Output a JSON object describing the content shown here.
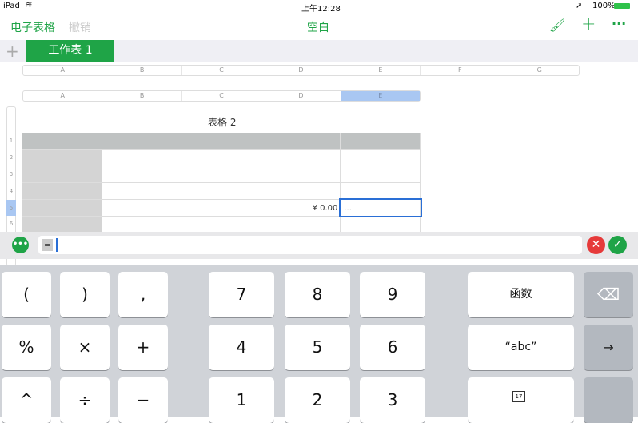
{
  "status": {
    "device": "iPad",
    "time": "上午12:28",
    "battery": "100%"
  },
  "toolbar": {
    "back": "电子表格",
    "undo": "撤销",
    "title": "空白"
  },
  "sheet_tab": "工作表 1",
  "columns_top": [
    "A",
    "B",
    "C",
    "D",
    "E",
    "F",
    "G"
  ],
  "columns_table": [
    "A",
    "B",
    "C",
    "D",
    "E"
  ],
  "table_title": "表格 2",
  "row_numbers": [
    "1",
    "2",
    "3",
    "4",
    "5",
    "6"
  ],
  "cell_d5": "¥ 0.00",
  "cell_e5": "...",
  "formula": {
    "prefix": "="
  },
  "keys": {
    "lparen": "(",
    "rparen": ")",
    "comma": ",",
    "percent": "%",
    "times": "×",
    "plus": "+",
    "caret": "^",
    "divide": "÷",
    "minus": "−",
    "k7": "7",
    "k8": "8",
    "k9": "9",
    "k4": "4",
    "k5": "5",
    "k6": "6",
    "k1": "1",
    "k2": "2",
    "k3": "3",
    "functions": "函数",
    "text": "“abc”",
    "tab": "→",
    "date_day": "17"
  }
}
